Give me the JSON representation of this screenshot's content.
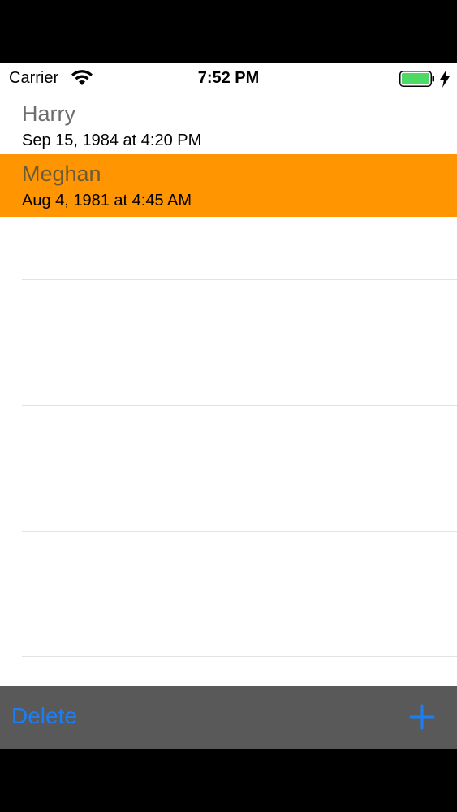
{
  "status_bar": {
    "carrier": "Carrier",
    "time": "7:52 PM",
    "icons": [
      "wifi-icon",
      "battery-icon",
      "charging-bolt-icon"
    ],
    "battery_color": "#4cd964"
  },
  "list": {
    "items": [
      {
        "name": "Harry",
        "date": "Sep 15, 1984 at 4:20 PM",
        "selected": false
      },
      {
        "name": "Meghan",
        "date": "Aug 4, 1981 at 4:45 AM",
        "selected": true
      }
    ],
    "selection_color": "#ff9500"
  },
  "toolbar": {
    "delete_label": "Delete",
    "add_icon": "plus-icon",
    "tint_color": "#1a7ff7"
  }
}
